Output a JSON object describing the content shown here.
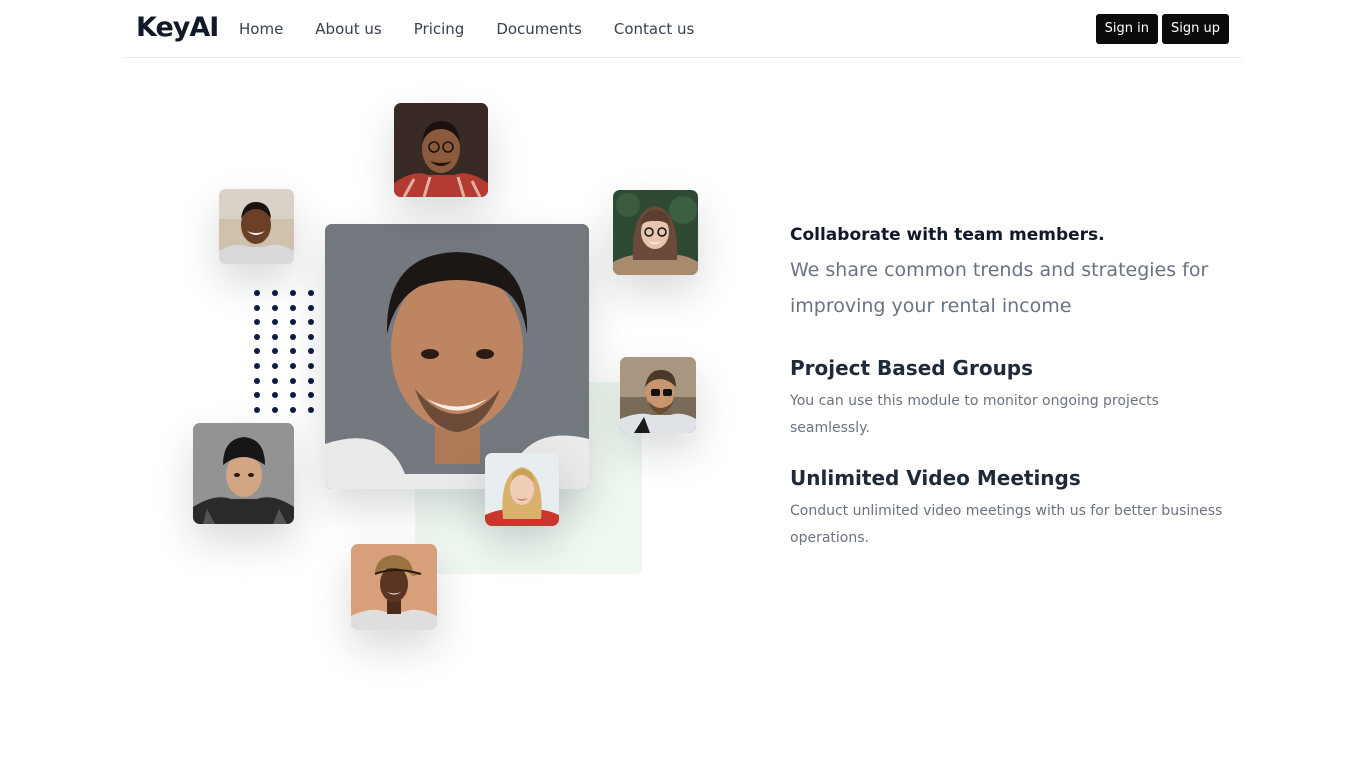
{
  "nav": {
    "logo": "KeyAI",
    "links": [
      "Home",
      "About us",
      "Pricing",
      "Documents",
      "Contact us"
    ],
    "signin": "Sign in",
    "signup": "Sign up"
  },
  "hero": {
    "kicker": "Collaborate with team members.",
    "lead": "We share common trends and strategies for improving your rental income",
    "features": [
      {
        "title": "Project Based Groups",
        "desc": "You can use this module to monitor ongoing projects seamlessly."
      },
      {
        "title": "Unlimited Video Meetings",
        "desc": "Conduct unlimited video meetings with us for better business operations."
      }
    ]
  },
  "colors": {
    "button_bg": "#0b0b0b",
    "accent_green": "#eef8f0",
    "dots": "#0f1a45"
  }
}
